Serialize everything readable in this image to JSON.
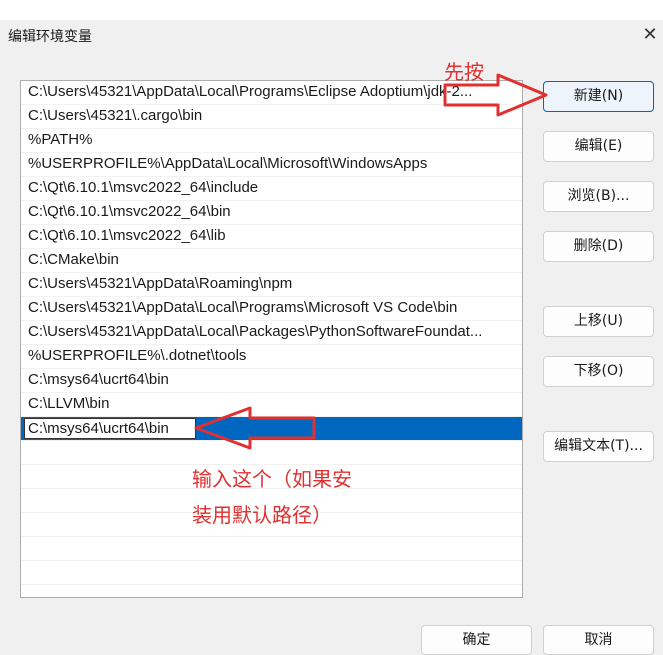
{
  "window": {
    "title": "编辑环境变量",
    "close_icon": "close-icon"
  },
  "paths": [
    "C:\\Users\\45321\\AppData\\Local\\Programs\\Eclipse Adoptium\\jdk-2...",
    "C:\\Users\\45321\\.cargo\\bin",
    "%PATH%",
    "%USERPROFILE%\\AppData\\Local\\Microsoft\\WindowsApps",
    "C:\\Qt\\6.10.1\\msvc2022_64\\include",
    "C:\\Qt\\6.10.1\\msvc2022_64\\bin",
    "C:\\Qt\\6.10.1\\msvc2022_64\\lib",
    "C:\\CMake\\bin",
    "C:\\Users\\45321\\AppData\\Roaming\\npm",
    "C:\\Users\\45321\\AppData\\Local\\Programs\\Microsoft VS Code\\bin",
    "C:\\Users\\45321\\AppData\\Local\\Packages\\PythonSoftwareFoundat...",
    "%USERPROFILE%\\.dotnet\\tools",
    "C:\\msys64\\ucrt64\\bin",
    "C:\\LLVM\\bin"
  ],
  "editing_value": "C:\\msys64\\ucrt64\\bin",
  "buttons": {
    "new": "新建(N)",
    "edit": "编辑(E)",
    "browse": "浏览(B)...",
    "delete": "删除(D)",
    "move_up": "上移(U)",
    "move_down": "下移(O)",
    "edit_text": "编辑文本(T)...",
    "ok": "确定",
    "cancel": "取消"
  },
  "annotations": {
    "first_click": "先按",
    "input_hint_line1": "输入这个（如果安",
    "input_hint_line2": "装用默认路径）"
  },
  "colors": {
    "selection": "#0067c0",
    "annotation": "#e03030"
  }
}
